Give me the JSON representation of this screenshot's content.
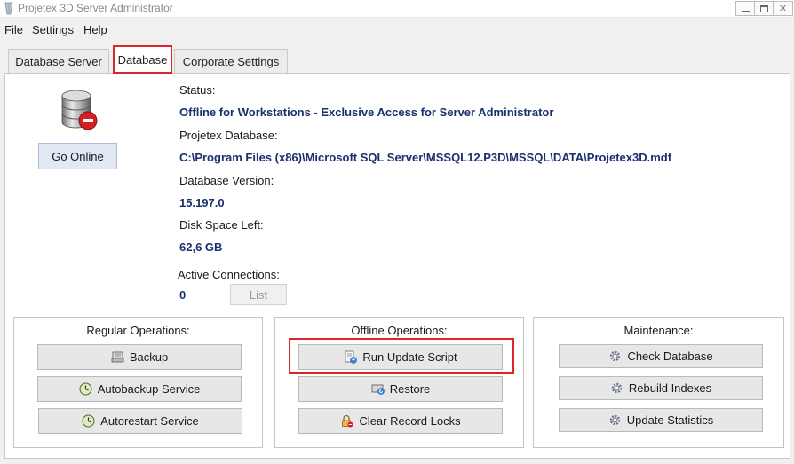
{
  "window": {
    "title": "Projetex 3D Server Administrator"
  },
  "menu": [
    {
      "accel": "F",
      "rest": "ile"
    },
    {
      "accel": "S",
      "rest": "ettings"
    },
    {
      "accel": "H",
      "rest": "elp"
    }
  ],
  "tabs": [
    {
      "label": "Database Server"
    },
    {
      "label": "Database",
      "active": true
    },
    {
      "label": "Corporate Settings"
    }
  ],
  "status_panel": {
    "go_online_label": "Go Online",
    "status_label": "Status:",
    "status_value": "Offline for Workstations -  Exclusive Access for Server Administrator",
    "database_label": "Projetex Database:",
    "database_value": "C:\\Program Files (x86)\\Microsoft SQL Server\\MSSQL12.P3D\\MSSQL\\DATA\\Projetex3D.mdf",
    "version_label": "Database Version:",
    "version_value": "15.197.0",
    "disk_label": "Disk Space Left:",
    "disk_value": "62,6 GB",
    "connections_label": "Active Connections:",
    "connections_value": "0",
    "list_label": "List"
  },
  "groups": {
    "regular": {
      "title": "Regular Operations:",
      "buttons": [
        {
          "label": "Backup",
          "icon": "backup-drive-icon"
        },
        {
          "label": "Autobackup Service",
          "icon": "clock-icon"
        },
        {
          "label": "Autorestart Service",
          "icon": "clock-icon"
        }
      ]
    },
    "offline": {
      "title": "Offline Operations:",
      "buttons": [
        {
          "label": "Run Update Script",
          "icon": "update-script-icon"
        },
        {
          "label": "Restore",
          "icon": "restore-icon"
        },
        {
          "label": "Clear Record Locks",
          "icon": "lock-icon"
        }
      ]
    },
    "maintenance": {
      "title": "Maintenance:",
      "buttons": [
        {
          "label": "Check Database",
          "icon": "gear-icon"
        },
        {
          "label": "Rebuild Indexes",
          "icon": "gear-icon"
        },
        {
          "label": "Update Statistics",
          "icon": "gear-icon"
        }
      ]
    }
  },
  "colors": {
    "highlight": "#d8262a",
    "value_text": "#1a2f6e",
    "go_online_bg": "#e2e8f4"
  }
}
